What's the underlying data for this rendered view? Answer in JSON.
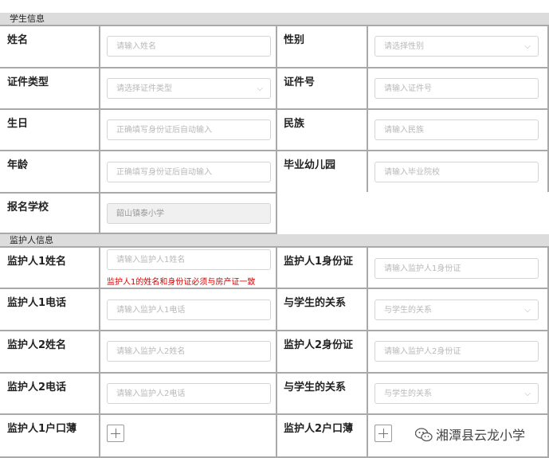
{
  "sections": {
    "student": "学生信息",
    "guardian": "监护人信息"
  },
  "student_fields": [
    {
      "label": "姓名",
      "placeholder": "请输入姓名"
    },
    {
      "label": "性别",
      "placeholder": "请选择性别",
      "select": true
    },
    {
      "label": "证件类型",
      "placeholder": "请选择证件类型",
      "select": true
    },
    {
      "label": "证件号",
      "placeholder": "请输入证件号"
    },
    {
      "label": "生日",
      "placeholder": "正确填写身份证后自动输入"
    },
    {
      "label": "民族",
      "placeholder": "请输入民族"
    },
    {
      "label": "年龄",
      "placeholder": "正确填写身份证后自动输入"
    },
    {
      "label": "毕业幼儿园",
      "placeholder": "请输入毕业院校"
    },
    {
      "label": "报名学校",
      "value": "韶山镇泰小学"
    }
  ],
  "guardian_fields": [
    {
      "label": "监护人1姓名",
      "placeholder": "请输入监护人1姓名",
      "warning": "监护人1的姓名和身份证必须与房产证一致"
    },
    {
      "label": "监护人1身份证",
      "placeholder": "请输入监护人1身份证"
    },
    {
      "label": "监护人1电话",
      "placeholder": "请输入监护人1电话"
    },
    {
      "label": "与学生的关系",
      "placeholder": "与学生的关系",
      "select": true
    },
    {
      "label": "监护人2姓名",
      "placeholder": "请输入监护人2姓名"
    },
    {
      "label": "监护人2身份证",
      "placeholder": "请输入监护人2身份证"
    },
    {
      "label": "监护人2电话",
      "placeholder": "请输入监护人2电话"
    },
    {
      "label": "与学生的关系",
      "placeholder": "与学生的关系",
      "select": true
    },
    {
      "label": "监护人1户口薄",
      "upload": true
    },
    {
      "label": "监护人2户口薄",
      "upload": true
    }
  ],
  "watermark": "湘潭县云龙小学",
  "icons": {
    "select": "chevron-down-icon",
    "upload": "plus-icon",
    "watermark": "wechat-icon"
  }
}
